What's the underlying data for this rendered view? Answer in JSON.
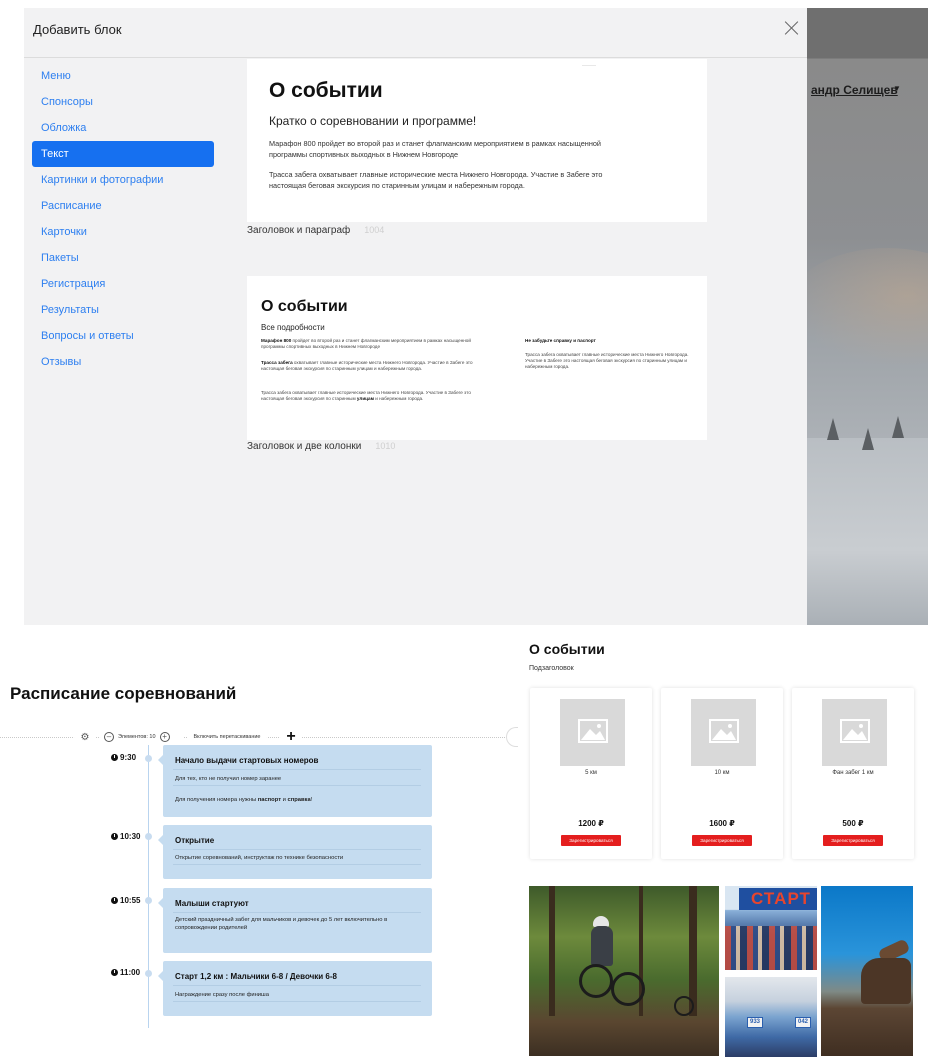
{
  "background": {
    "user_name": "андр Селищев",
    "caret": "▼"
  },
  "modal": {
    "title": "Добавить блок",
    "close_icon": "close-icon",
    "menu": [
      {
        "label": "Меню",
        "active": false
      },
      {
        "label": "Спонсоры",
        "active": false
      },
      {
        "label": "Обложка",
        "active": false
      },
      {
        "label": "Текст",
        "active": true
      },
      {
        "label": "Картинки и фотографии",
        "active": false
      },
      {
        "label": "Расписание",
        "active": false
      },
      {
        "label": "Карточки",
        "active": false
      },
      {
        "label": "Пакеты",
        "active": false
      },
      {
        "label": "Регистрация",
        "active": false
      },
      {
        "label": "Результаты",
        "active": false
      },
      {
        "label": "Вопросы и ответы",
        "active": false
      },
      {
        "label": "Отзывы",
        "active": false
      }
    ],
    "templates": [
      {
        "heading": "О событии",
        "subheading": "Кратко о соревновании и программе!",
        "paragraph_1": "Марафон 800 пройдет во второй раз и станет флагманским мероприятием в рамках насыщенной программы спортивных выходных в Нижнем Новгороде",
        "paragraph_2": "Трасса забега охватывает главные исторические места Нижнего Новгорода. Участие в Забеге это настоящая беговая экскурсия по старинным улицам и набережным города.",
        "caption": "Заголовок и параграф",
        "code": "1004"
      },
      {
        "heading": "О событии",
        "subheading": "Все подробности",
        "col1_p1_bold": "Марафон 800",
        "col1_p1_rest": " пройдет во второй раз и станет флагманским мероприятием в рамках насыщенной программы спортивных выходных в Нижнем Новгороде",
        "col1_p2_bold": "Трасса забега",
        "col1_p2_rest": " охватывает главные исторические места Нижнего Новгорода. Участие в Забеге это настоящая беговая экскурсия по старинным улицам и набережным города.",
        "col1_p3_start": "Трасса забега охватывает главные исторические места Нижнего Новгорода. Участие в Забеге это настоящая беговая экскурсия по старинным ",
        "col1_p3_bold": "улицам",
        "col1_p3_end": " и набережным города.",
        "col2_heading": "Не забудьте справку и паспорт",
        "col2_text": "Трасса забега охватывает главные исторические места Нижнего Новгорода. Участие в Забеге это настоящая беговая экскурсия по старинным улицам и набережным города.",
        "caption": "Заголовок и две колонки",
        "code": "1010"
      }
    ]
  },
  "schedule": {
    "title": "Расписание соревнований",
    "toolbar": {
      "gear_icon": "gear-icon",
      "elements_label": "Элементов: 10",
      "minus": "–",
      "plus_small": "+",
      "drag_label": "Включить перетаскивание",
      "add": "+"
    },
    "items": [
      {
        "time": "9:30",
        "title": "Начало выдачи стартовых номеров",
        "line1": "Для тех, кто не получил номер заранее",
        "line2_start": "Для получения номера нужны ",
        "line2_b1": "паспорт",
        "line2_mid": " и ",
        "line2_b2": "справка",
        "line2_end": "!"
      },
      {
        "time": "10:30",
        "title": "Открытие",
        "line1": "Открытие соревнований, инструктаж по технике безопасности"
      },
      {
        "time": "10:55",
        "title": "Малыши стартуют",
        "line1": "Детский праздничный забег для мальчиков и девочек до 5 лет включительно в сопровождении родителей"
      },
      {
        "time": "11:00",
        "title": "Старт 1,2 км : Мальчики 6-8 / Девочки 6-8",
        "line1": "Награждение сразу после финиша"
      }
    ]
  },
  "packages": {
    "title": "О событии",
    "subtitle": "Подзаголовок",
    "items": [
      {
        "name": "5 км",
        "price": "1200 ₽",
        "button": "Зарегистрироваться"
      },
      {
        "name": "10 км",
        "price": "1600 ₽",
        "button": "Зарегистрироваться"
      },
      {
        "name": "Фан забег 1 км",
        "price": "500 ₽",
        "button": "Зарегистрироваться"
      }
    ]
  },
  "photos": {
    "banner_text": "СТАРТ",
    "bibs": [
      "933",
      "042"
    ]
  }
}
